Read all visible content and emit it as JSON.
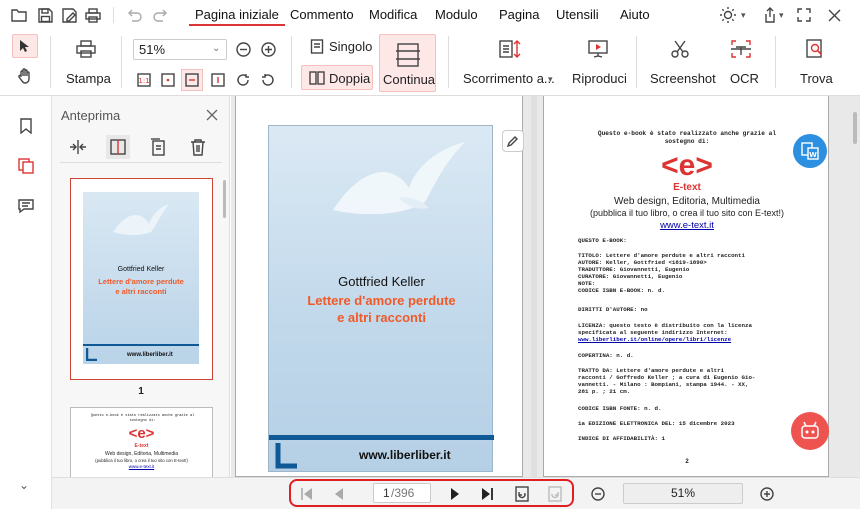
{
  "menu": {
    "tabs": [
      {
        "label": "Pagina iniziale",
        "active": true
      },
      {
        "label": "Commento"
      },
      {
        "label": "Modifica"
      },
      {
        "label": "Modulo"
      },
      {
        "label": "Pagina"
      },
      {
        "label": "Utensili"
      },
      {
        "label": "Aiuto"
      }
    ]
  },
  "ribbon": {
    "print_label": "Stampa",
    "zoom_value": "51%",
    "single_label": "Singolo",
    "double_label": "Doppia",
    "continuous_label": "Continua",
    "scroll_label": "Scorrimento a...",
    "play_label": "Riproduci",
    "screenshot_label": "Screenshot",
    "ocr_label": "OCR",
    "find_label": "Trova"
  },
  "panel": {
    "title": "Anteprima",
    "thumb1_page": "1",
    "thumb1_author": "Gottfried Keller",
    "thumb1_title_line1": "Lettere d'amore perdute",
    "thumb1_title_line2": "e altri racconti",
    "thumb1_site": "www.liberliber.it"
  },
  "page1": {
    "author": "Gottfried Keller",
    "title_line1": "Lettere d'amore perdute",
    "title_line2": "e altri racconti",
    "site": "www.liberliber.it"
  },
  "page2": {
    "intro_line1": "Questo e-book è stato realizzato anche grazie al",
    "intro_line2": "sostegno di:",
    "logo_text": "<e>",
    "logo_sub": "E-text",
    "tagline1": "Web design, Editoria, Multimedia",
    "tagline2": "(pubblica il tuo libro, o crea il tuo sito con E-text!)",
    "tagline_link": "www.e-text.it",
    "ebook_heading": "QUESTO E-BOOK:",
    "meta_title": "TITOLO: Lettere d'amore perdute e altri racconti",
    "meta_author": "AUTORE: Keller, Gottfried <1819-1890>",
    "meta_translator": "TRADUTTORE: Giovannetti, Eugenio",
    "meta_curator": "CURATORE: Giovannetti, Eugenio",
    "meta_note": "NOTE:",
    "meta_isbn": "CODICE ISBN E-BOOK: n. d.",
    "rights": "DIRITTI D'AUTORE: no",
    "license1": "LICENZA: questo testo è distribuito con la licenza",
    "license2": "specificata    al    seguente    indirizzo    Internet:",
    "license_link": "www.liberliber.it/online/opere/libri/licenze",
    "cover": "COPERTINA: n. d.",
    "source1": "TRATTO   DA:   Lettere   d'amore   perdute   e   altri",
    "source2": "racconti / Goffredo Keller ; a cura di Eugenio Gio-",
    "source3": "vannetti. - Milano : Bompiani, stampa 1944. - XX,",
    "source4": "281 p. ; 21 cm.",
    "isbn_source": "CODICE ISBN FONTE: n. d.",
    "edition": "1a EDIZIONE ELETTRONICA DEL: 15 dicembre 2023",
    "reliability": "INDICE DI AFFIDABILITÀ: 1",
    "page_number": "2"
  },
  "thumb2": {
    "intro_line1": "Questo e-book è stato realizzato anche grazie al",
    "intro_line2": "sostegno di:",
    "logo_text": "<e>",
    "logo_sub": "E-text",
    "tagline1": "Web design, Editoria, Multimedia",
    "tagline2": "(pubblica il tuo libro, o crea il tuo sito con E-text!)",
    "tagline_link": "www.e-text.it"
  },
  "nav": {
    "current_page": "1",
    "total_pages": "/396",
    "zoom_value": "51%"
  },
  "colors": {
    "accent": "#d33333",
    "title_orange": "#f05a28",
    "cover_blue": "#c6dcec",
    "cover_bar": "#0f5a96"
  }
}
